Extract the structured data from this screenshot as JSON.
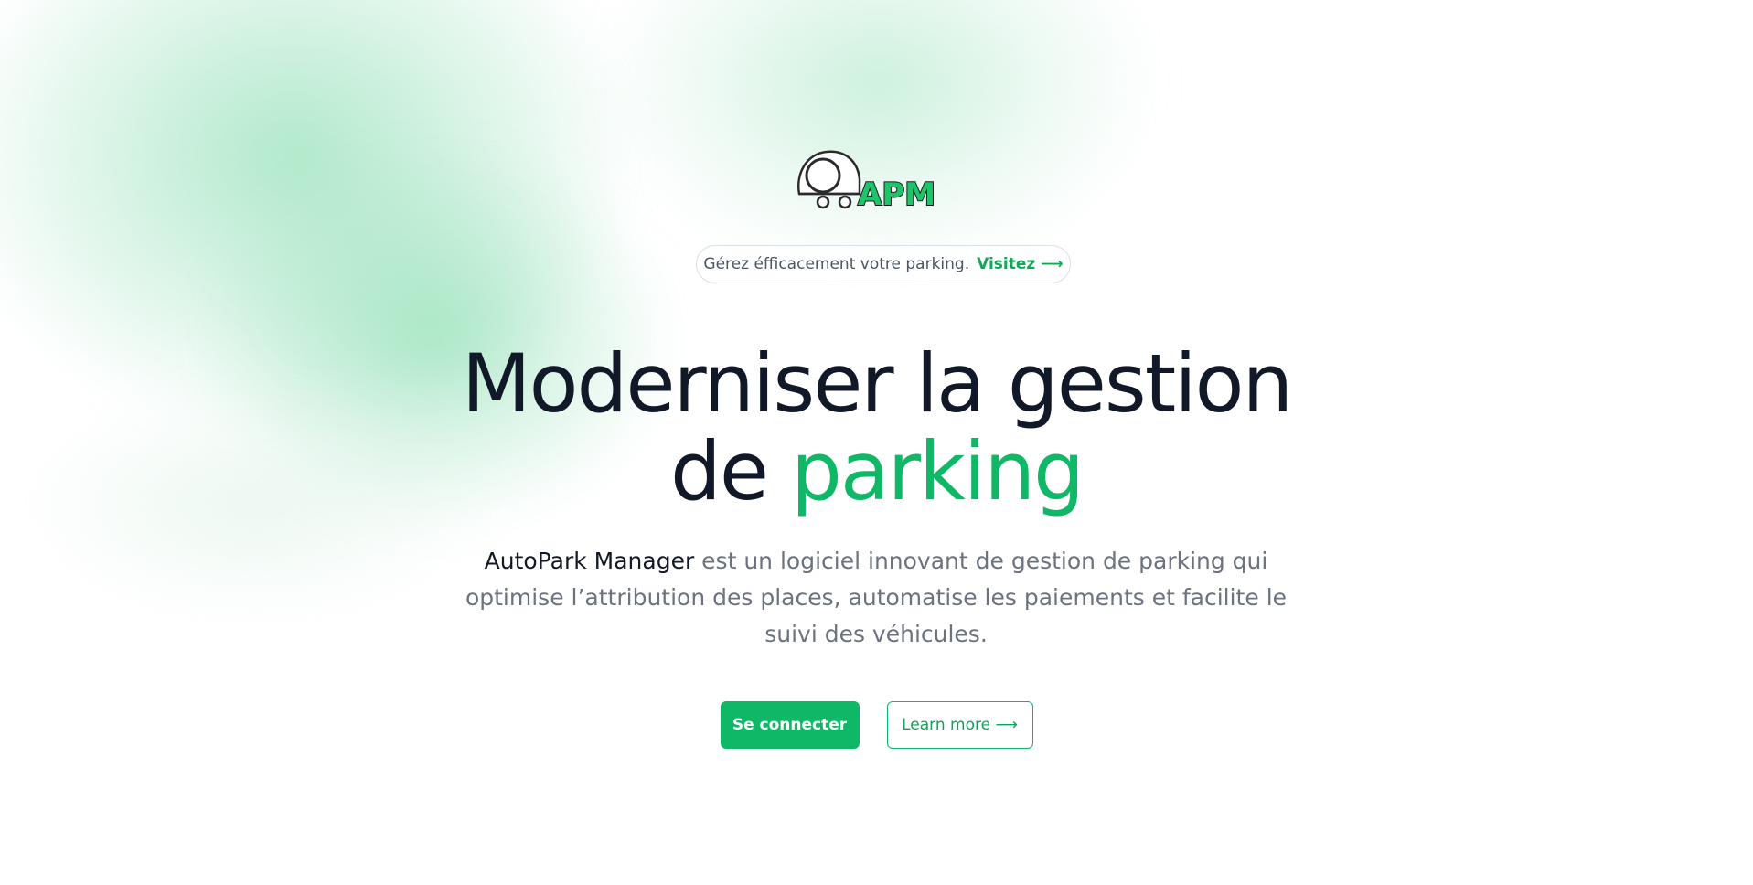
{
  "brand": {
    "logo_text": "APM"
  },
  "announcement": {
    "text": "Gérez éfficacement votre parking.",
    "link_label": "Visitez ⟶"
  },
  "hero": {
    "title_line1": "Moderniser la gestion",
    "title_line2_prefix": "de",
    "title_line2_accent": "parking",
    "description_brand": "AutoPark Manager",
    "description_rest": " est un logiciel innovant de gestion de parking qui optimise l’attribution des places, automatise les paiements et facilite le suivi des véhicules."
  },
  "actions": {
    "primary_label": "Se connecter",
    "secondary_label": "Learn more ⟶"
  },
  "colors": {
    "accent": "#0fb866",
    "text_dark": "#111827",
    "text_muted": "#6b7280"
  }
}
